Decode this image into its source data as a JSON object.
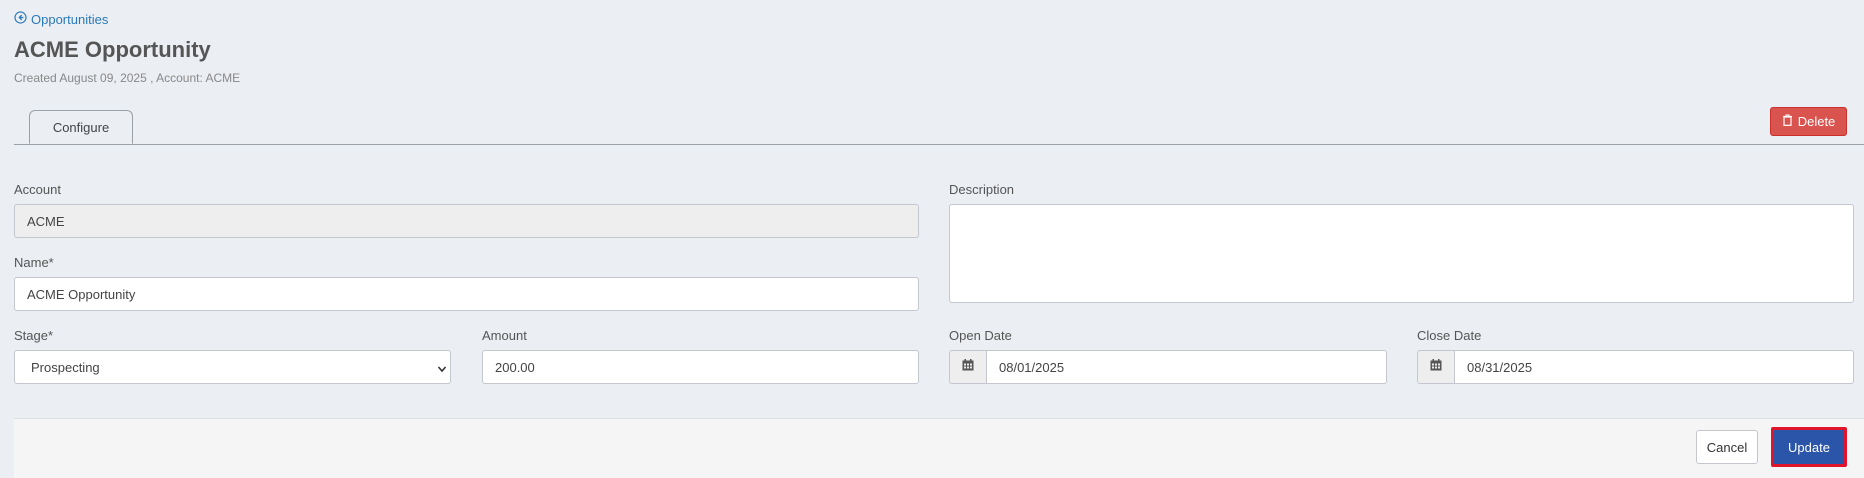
{
  "breadcrumb": {
    "label": "Opportunities"
  },
  "page": {
    "title": "ACME Opportunity",
    "subtitle": "Created August 09, 2025 , Account: ACME"
  },
  "tabs": [
    {
      "label": "Configure",
      "active": true
    }
  ],
  "toolbar": {
    "delete_label": "Delete"
  },
  "form": {
    "account": {
      "label": "Account",
      "value": "ACME"
    },
    "name": {
      "label": "Name*",
      "value": "ACME Opportunity"
    },
    "description": {
      "label": "Description",
      "value": ""
    },
    "stage": {
      "label": "Stage*",
      "value": "Prospecting"
    },
    "amount": {
      "label": "Amount",
      "value": "200.00"
    },
    "open_date": {
      "label": "Open Date",
      "value": "08/01/2025"
    },
    "close_date": {
      "label": "Close Date",
      "value": "08/31/2025"
    }
  },
  "footer": {
    "cancel_label": "Cancel",
    "update_label": "Update"
  },
  "colors": {
    "accent": "#2a55a8",
    "danger": "#d9534f",
    "link": "#2a7ab8",
    "highlight": "#e0142a"
  },
  "icons": {
    "back": "arrow-circle-left-icon",
    "delete": "trash-icon",
    "calendar": "calendar-icon",
    "select": "chevron-down-icon"
  }
}
